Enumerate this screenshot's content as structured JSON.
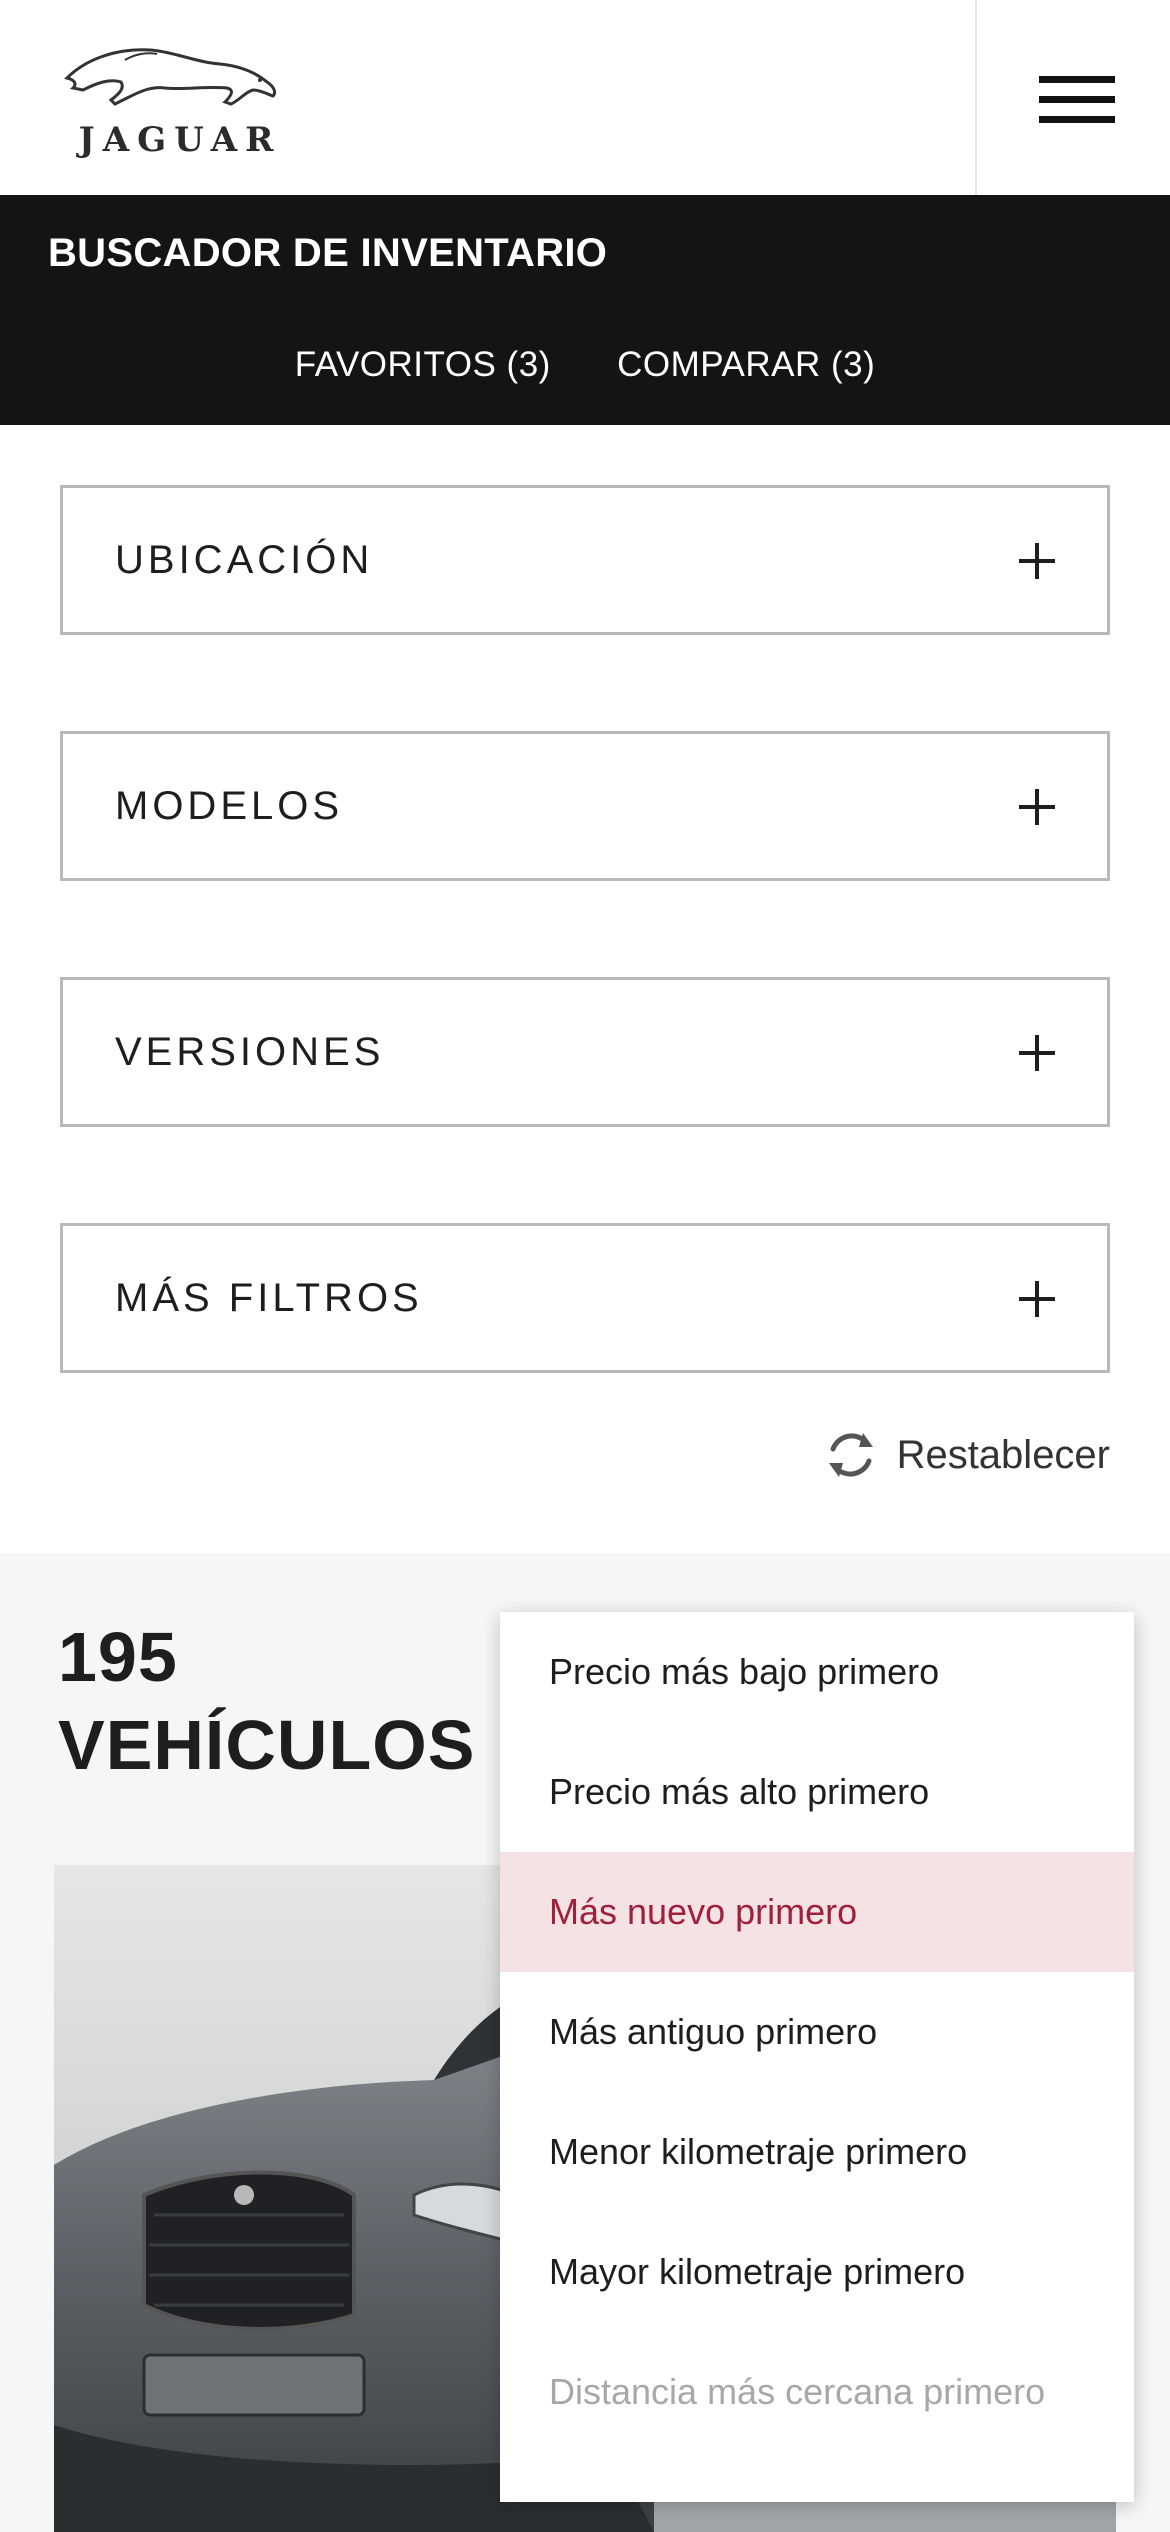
{
  "header": {
    "logo_text": "JAGUAR",
    "menu_icon": "hamburger-menu-icon"
  },
  "topbar": {
    "title": "BUSCADOR DE INVENTARIO",
    "favorites": "FAVORITOS (3)",
    "compare": "COMPARAR (3)"
  },
  "filters": [
    {
      "label": "UBICACIÓN",
      "icon": "plus-icon"
    },
    {
      "label": "MODELOS",
      "icon": "plus-icon"
    },
    {
      "label": "VERSIONES",
      "icon": "plus-icon"
    },
    {
      "label": "MÁS FILTROS",
      "icon": "plus-icon"
    }
  ],
  "reset": {
    "label": "Restablecer",
    "icon": "refresh-icon"
  },
  "results": {
    "count": "195",
    "count_label": "VEHÍCULOS"
  },
  "sort_dropdown": {
    "options": [
      "Precio más bajo primero",
      "Precio más alto primero",
      "Más nuevo primero",
      "Más antiguo primero",
      "Menor kilometraje primero",
      "Mayor kilometraje primero",
      "Distancia más cercana primero"
    ],
    "selected": "Más nuevo primero",
    "disabled": "Distancia más cercana primero"
  },
  "colors": {
    "accent": "#a0203c",
    "selected_bg": "#f4e2e5",
    "topbar_bg": "#141414"
  }
}
